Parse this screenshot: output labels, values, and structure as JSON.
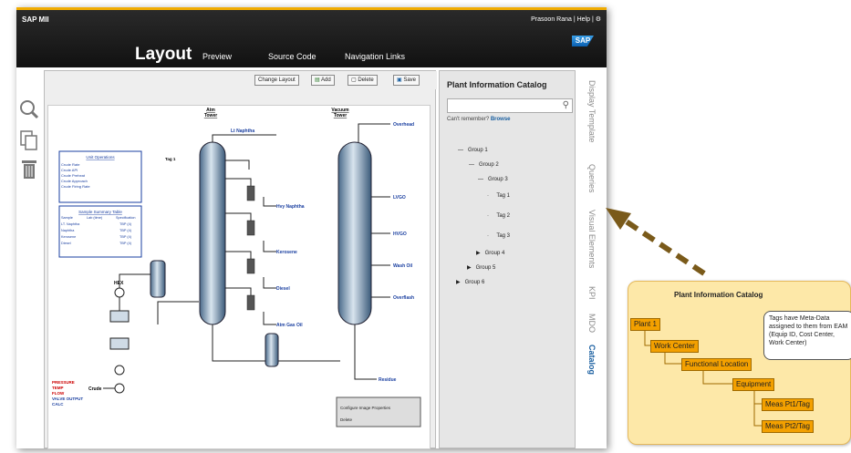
{
  "header": {
    "app_name": "SAP MII",
    "user_links": "Prasoon Rana | Help |",
    "logo_text": "SAP",
    "tabs": [
      {
        "label": "Layout",
        "active": true
      },
      {
        "label": "Preview"
      },
      {
        "label": "Source Code"
      },
      {
        "label": "Navigation Links"
      }
    ]
  },
  "toolbar": {
    "change_layout": "Change Layout",
    "add": "Add",
    "delete": "Delete",
    "save": "Save"
  },
  "diagram": {
    "atm_tower": [
      "Atm",
      "Tower"
    ],
    "vacuum_tower": [
      "Vacuum",
      "Tower"
    ],
    "unit_ops_title": "Unit Operations",
    "unit_ops_rows": [
      "Crude Rate",
      "Crude API",
      "Crude Preheat",
      "Crude Approach",
      "Crude Firing Rate"
    ],
    "summary_title": "Sample Summary Table",
    "summary_header": [
      "Sample",
      "Lab (time)",
      "Specification"
    ],
    "summary_rows": [
      [
        "LT. Naphtha",
        "TBP (4)"
      ],
      [
        "Naphtha",
        "TBP (4)"
      ],
      [
        "Kerosene",
        "TBP (4)"
      ],
      [
        "Diesel",
        "TBP (4)"
      ]
    ],
    "atm_outputs": [
      "Lt Naphtha",
      "Hvy Naphtha",
      "Kerosene",
      "Diesel",
      "Atm Gas Oil"
    ],
    "vac_outputs": [
      "Overhead",
      "LVGO",
      "HVGO",
      "Wash Oil",
      "Overflash",
      "Residue"
    ],
    "tag1": "Tag 1",
    "hex": "HEX",
    "crude": "Crude",
    "legend": [
      {
        "label": "PRESSURE",
        "color": "#cc0000"
      },
      {
        "label": "TEMP",
        "color": "#cc0000"
      },
      {
        "label": "FLOW",
        "color": "#cc0000"
      },
      {
        "label": "VALVE OUTPUT",
        "color": "#1a3fa0"
      },
      {
        "label": "CALC",
        "color": "#1a3fa0"
      }
    ],
    "context_menu": [
      "Configure Image Properties",
      "Delete"
    ]
  },
  "catalog": {
    "title": "Plant Information Catalog",
    "search_placeholder": "",
    "remember_text": "Can't remember?",
    "browse_link": "Browse",
    "tree": [
      {
        "label": "Group 1",
        "marker": "—"
      },
      {
        "label": "Group 2",
        "marker": "—"
      },
      {
        "label": "Group 3",
        "marker": "—"
      },
      {
        "label": "Tag 1",
        "marker": "·"
      },
      {
        "label": "Tag 2",
        "marker": "·"
      },
      {
        "label": "Tag 3",
        "marker": "·"
      },
      {
        "label": "Group 4",
        "marker": "▶"
      },
      {
        "label": "Group 5",
        "marker": "▶"
      },
      {
        "label": "Group 6",
        "marker": "▶"
      }
    ]
  },
  "side_tabs": [
    "Display Template",
    "Queries",
    "Visual Elements",
    "KPI",
    "MDO",
    "Catalog"
  ],
  "callout": {
    "title": "Plant Information Catalog",
    "nodes": [
      "Plant 1",
      "Work Center",
      "Functional Location",
      "Equipment",
      "Meas Pt1/Tag",
      "Meas Pt2/Tag"
    ],
    "note": "Tags have Meta-Data assigned to them from EAM (Equip ID, Cost Center, Work Center)"
  },
  "colors": {
    "accent": "#f0ab00",
    "header_bg": "#1a1a1a",
    "callout_bg": "#fde8a8",
    "node_bg": "#f3a000",
    "arrow": "#7a5a1a",
    "link": "#1a5fa0"
  }
}
